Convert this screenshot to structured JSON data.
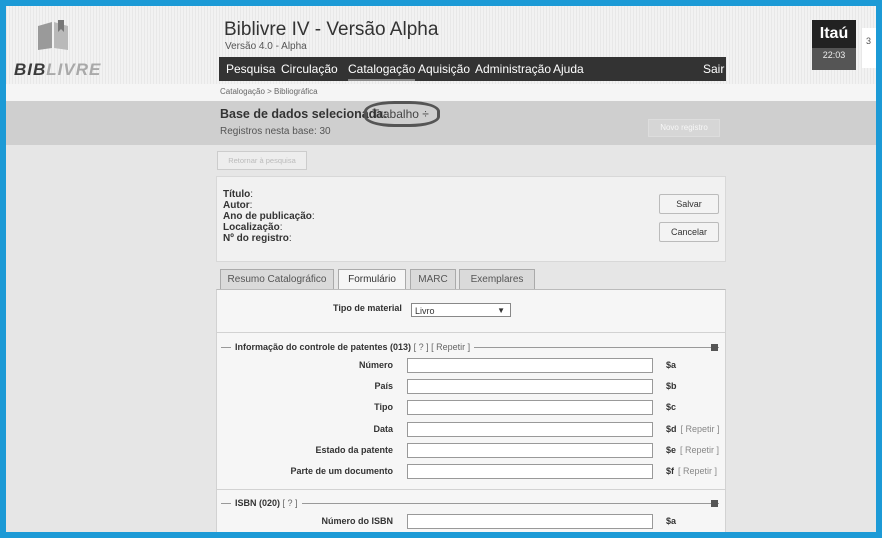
{
  "header": {
    "logo_text_a": "BIB",
    "logo_text_b": "LIVRE",
    "title": "Biblivre IV - Versão Alpha",
    "version": "Versão 4.0 - Alpha"
  },
  "menu": [
    {
      "label": "Pesquisa"
    },
    {
      "label": "Circulação"
    },
    {
      "label": "Catalogação"
    },
    {
      "label": "Aquisição"
    },
    {
      "label": "Administração"
    },
    {
      "label": "Ajuda"
    },
    {
      "label": "Sair"
    }
  ],
  "bank": {
    "name": "Itaú",
    "time": "22:03",
    "edge": "3"
  },
  "breadcrumb": "Catalogação > Bibliográfica",
  "database": {
    "label": "Base de dados selecionada:",
    "selected": "Trabalho ÷",
    "count": "Registros nesta base: 30",
    "new_record": "Novo registro"
  },
  "back_button": "Retornar à pesquisa",
  "record_info": [
    {
      "label": "Título",
      "value": ":"
    },
    {
      "label": "Autor",
      "value": ":"
    },
    {
      "label": "Ano de publicação",
      "value": ":"
    },
    {
      "label": "Localização",
      "value": ":"
    },
    {
      "label": "Nº do registro",
      "value": ":"
    }
  ],
  "actions": {
    "save": "Salvar",
    "cancel": "Cancelar"
  },
  "tabs": [
    {
      "label": "Resumo Catalográfico"
    },
    {
      "label": "Formulário"
    },
    {
      "label": "MARC"
    },
    {
      "label": "Exemplares"
    }
  ],
  "material": {
    "label": "Tipo de material",
    "value": "Livro",
    "arrow": "▼"
  },
  "fieldsets": [
    {
      "legend": "Informação do controle de patentes  (013)",
      "help": "[ ? ]",
      "repeat": "[ Repetir ]",
      "fields": [
        {
          "label": "Número",
          "code": "$a",
          "repeat": ""
        },
        {
          "label": "País",
          "code": "$b",
          "repeat": ""
        },
        {
          "label": "Tipo",
          "code": "$c",
          "repeat": ""
        },
        {
          "label": "Data",
          "code": "$d",
          "repeat": "[ Repetir ]"
        },
        {
          "label": "Estado da patente",
          "code": "$e",
          "repeat": "[ Repetir ]"
        },
        {
          "label": "Parte de um documento",
          "code": "$f",
          "repeat": "[ Repetir ]"
        }
      ]
    },
    {
      "legend": "ISBN  (020)",
      "help": "[ ? ]",
      "repeat": "",
      "fields": [
        {
          "label": "Número do ISBN",
          "code": "$a",
          "repeat": ""
        }
      ]
    }
  ]
}
